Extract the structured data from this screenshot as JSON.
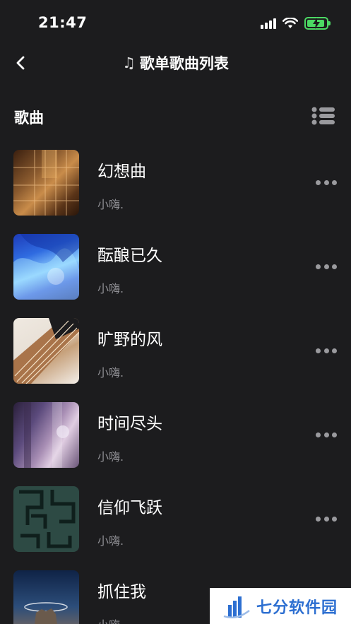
{
  "status_bar": {
    "time": "21:47",
    "icons": [
      "signal-icon",
      "wifi-icon",
      "battery-charging-icon"
    ],
    "battery_color": "#4cd964"
  },
  "nav": {
    "back_icon": "chevron-left-icon",
    "title_icon": "music-note-icon",
    "title": "歌单歌曲列表"
  },
  "section": {
    "title": "歌曲",
    "toggle_icon": "list-icon"
  },
  "songs": [
    {
      "title": "幻想曲",
      "artist": "小嗨.",
      "more_icon": "more-horizontal-icon"
    },
    {
      "title": "酝酿已久",
      "artist": "小嗨.",
      "more_icon": "more-horizontal-icon"
    },
    {
      "title": "旷野的风",
      "artist": "小嗨.",
      "more_icon": "more-horizontal-icon"
    },
    {
      "title": "时间尽头",
      "artist": "小嗨.",
      "more_icon": "more-horizontal-icon"
    },
    {
      "title": "信仰飞跃",
      "artist": "小嗨.",
      "more_icon": "more-horizontal-icon"
    },
    {
      "title": "抓住我",
      "artist": "小嗨.",
      "more_icon": "more-horizontal-icon"
    }
  ],
  "watermark": {
    "text": "七分软件园"
  },
  "colors": {
    "background": "#1c1c1e",
    "secondary_text": "#8e8e93",
    "watermark_blue": "#2d6fd1"
  }
}
